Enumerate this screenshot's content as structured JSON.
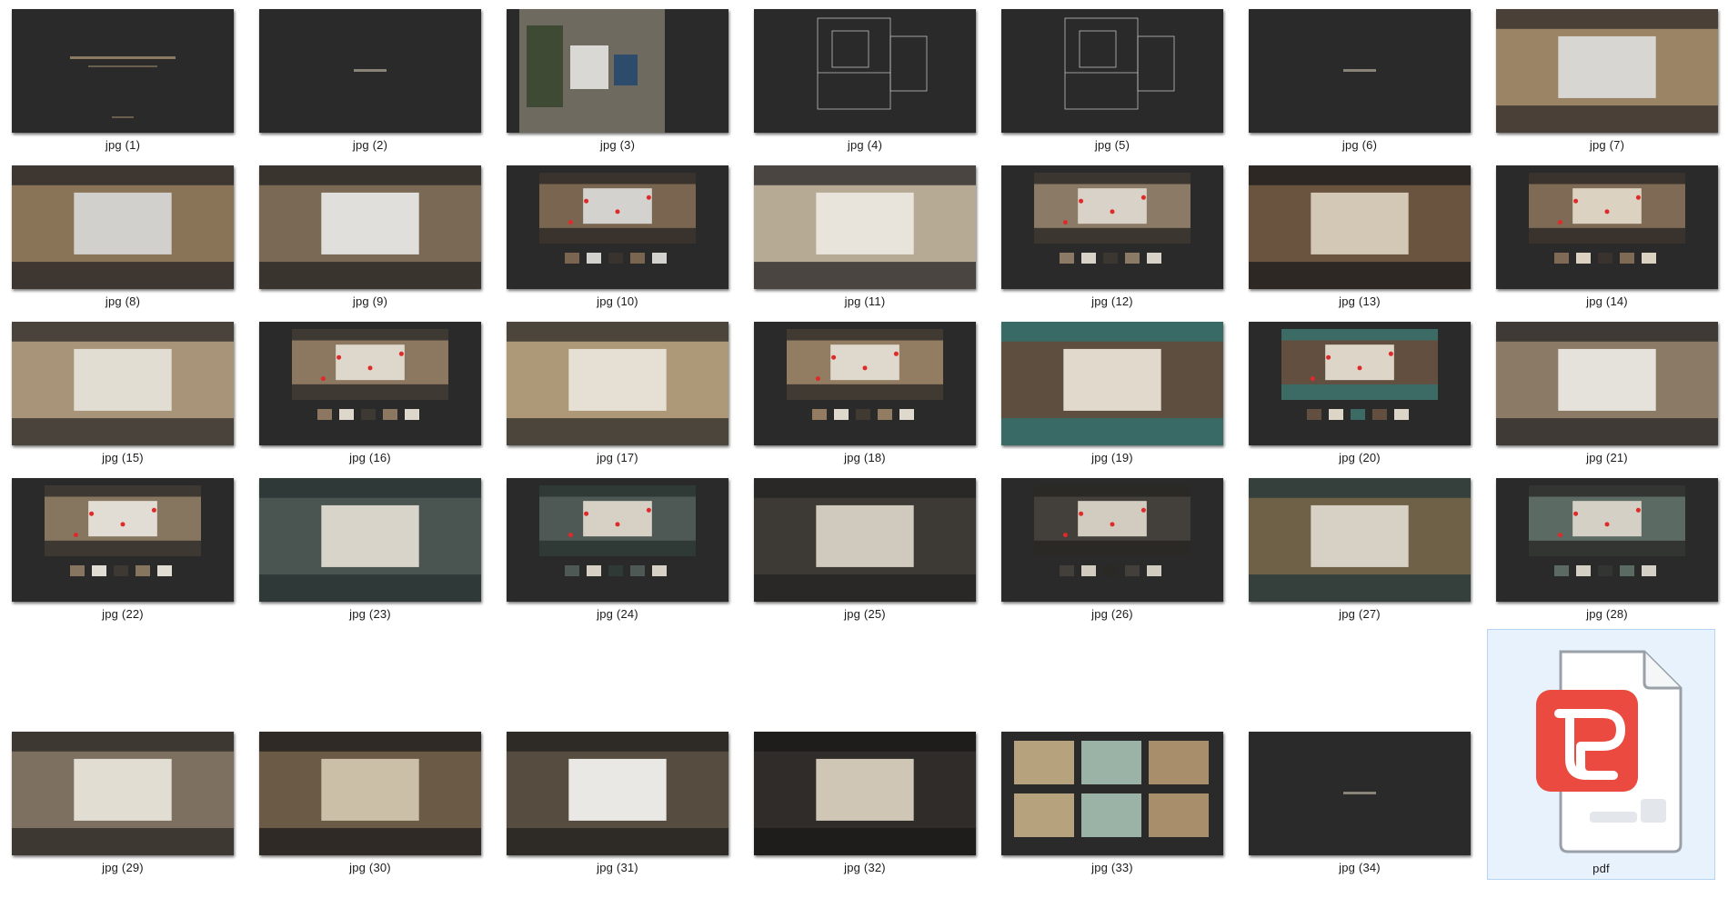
{
  "files": [
    {
      "label": "jpg (1)",
      "kind": "title",
      "colors": [
        "#2a2a2b",
        "#3a3834",
        "#6a5a44"
      ]
    },
    {
      "label": "jpg (2)",
      "kind": "section",
      "colors": [
        "#2a2a2b"
      ]
    },
    {
      "label": "jpg (3)",
      "kind": "plan",
      "colors": [
        "#6e6a60",
        "#3f4a34",
        "#d9d8d4"
      ]
    },
    {
      "label": "jpg (4)",
      "kind": "cad",
      "colors": [
        "#2a2a2b"
      ]
    },
    {
      "label": "jpg (5)",
      "kind": "cad",
      "colors": [
        "#2a2a2b"
      ]
    },
    {
      "label": "jpg (6)",
      "kind": "section",
      "colors": [
        "#2a2a2b"
      ]
    },
    {
      "label": "jpg (7)",
      "kind": "render",
      "colors": [
        "#9a8465",
        "#d8d6d2",
        "#4a4038"
      ]
    },
    {
      "label": "jpg (8)",
      "kind": "render",
      "colors": [
        "#8a7458",
        "#d2d0cc",
        "#3e3630"
      ]
    },
    {
      "label": "jpg (9)",
      "kind": "render",
      "colors": [
        "#7a6a55",
        "#e0dfdc",
        "#3a342e"
      ]
    },
    {
      "label": "jpg (10)",
      "kind": "annotated",
      "colors": [
        "#7a6650",
        "#d4d2ce",
        "#3a332d"
      ]
    },
    {
      "label": "jpg (11)",
      "kind": "render",
      "colors": [
        "#b7aa95",
        "#e8e4dc",
        "#4a4540"
      ]
    },
    {
      "label": "jpg (12)",
      "kind": "annotated",
      "colors": [
        "#8b7a66",
        "#d8d2c8",
        "#3c3631"
      ]
    },
    {
      "label": "jpg (13)",
      "kind": "render",
      "colors": [
        "#6a5440",
        "#d3c8b6",
        "#2e2824"
      ]
    },
    {
      "label": "jpg (14)",
      "kind": "annotated",
      "colors": [
        "#7e6a55",
        "#dcd2c2",
        "#3a322c"
      ]
    },
    {
      "label": "jpg (15)",
      "kind": "render",
      "colors": [
        "#a89478",
        "#e2ddd3",
        "#4a433b"
      ]
    },
    {
      "label": "jpg (16)",
      "kind": "annotated",
      "colors": [
        "#8c7760",
        "#ddd7cc",
        "#3f3933"
      ]
    },
    {
      "label": "jpg (17)",
      "kind": "render",
      "colors": [
        "#ad9878",
        "#e6e0d4",
        "#4c453c"
      ]
    },
    {
      "label": "jpg (18)",
      "kind": "annotated",
      "colors": [
        "#927c62",
        "#dfd8cc",
        "#413a33"
      ]
    },
    {
      "label": "jpg (19)",
      "kind": "render",
      "colors": [
        "#5e4e40",
        "#e0d9cc",
        "#3a6a66"
      ]
    },
    {
      "label": "jpg (20)",
      "kind": "annotated",
      "colors": [
        "#634f40",
        "#ddd5c8",
        "#3c6a64"
      ]
    },
    {
      "label": "jpg (21)",
      "kind": "render",
      "colors": [
        "#8a7a66",
        "#e5e2dc",
        "#3f3a35"
      ]
    },
    {
      "label": "jpg (22)",
      "kind": "annotated",
      "colors": [
        "#86755f",
        "#e1ddd5",
        "#3e3833"
      ]
    },
    {
      "label": "jpg (23)",
      "kind": "render",
      "colors": [
        "#4a5450",
        "#d9d4ca",
        "#2f3a38"
      ]
    },
    {
      "label": "jpg (24)",
      "kind": "annotated",
      "colors": [
        "#4e5854",
        "#d6d0c5",
        "#2f3a37"
      ]
    },
    {
      "label": "jpg (25)",
      "kind": "render",
      "colors": [
        "#3d3a36",
        "#cfc9be",
        "#2a2826"
      ]
    },
    {
      "label": "jpg (26)",
      "kind": "annotated",
      "colors": [
        "#433f3a",
        "#d2ccc0",
        "#2b2926"
      ]
    },
    {
      "label": "jpg (27)",
      "kind": "render",
      "colors": [
        "#6f6048",
        "#d7d1c5",
        "#35403c"
      ]
    },
    {
      "label": "jpg (28)",
      "kind": "annotated",
      "colors": [
        "#5b6a63",
        "#d5d0c6",
        "#333532"
      ]
    },
    {
      "label": "jpg (29)",
      "kind": "render",
      "colors": [
        "#7e7060",
        "#e2ddd2",
        "#3d3832"
      ]
    },
    {
      "label": "jpg (30)",
      "kind": "render",
      "colors": [
        "#6a5a46",
        "#cbbfa8",
        "#2f2a25"
      ]
    },
    {
      "label": "jpg (31)",
      "kind": "render",
      "colors": [
        "#564c40",
        "#e9e8e5",
        "#2e2a26"
      ]
    },
    {
      "label": "jpg (32)",
      "kind": "render",
      "colors": [
        "#2f2c29",
        "#cfc6b6",
        "#1f1d1b"
      ]
    },
    {
      "label": "jpg (33)",
      "kind": "materials",
      "colors": [
        "#b7a27e",
        "#9bb2a6",
        "#a88e6a"
      ]
    },
    {
      "label": "jpg (34)",
      "kind": "section",
      "colors": [
        "#2a2a2b"
      ]
    }
  ],
  "pdf": {
    "label": "pdf",
    "icon": "wps-pdf-icon",
    "accent": "#e8463e"
  }
}
